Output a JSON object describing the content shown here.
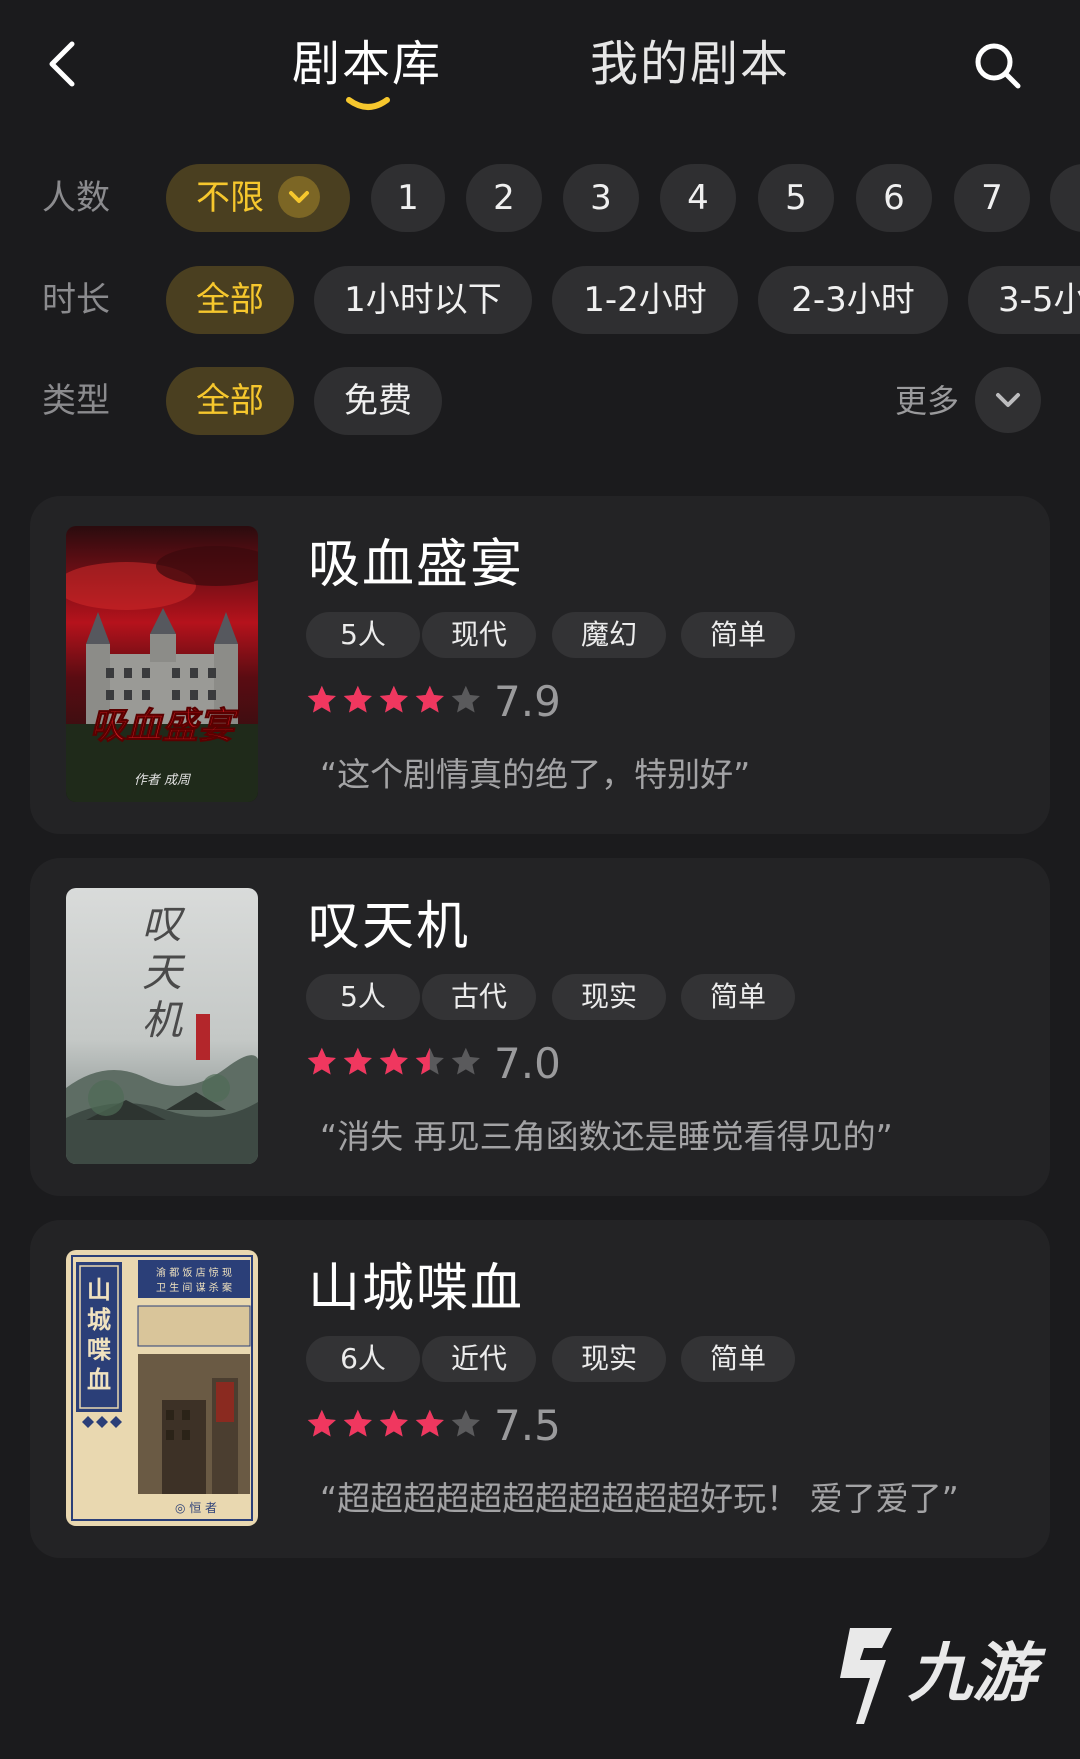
{
  "header": {
    "tabs": [
      {
        "label": "剧本库",
        "active": true
      },
      {
        "label": "我的剧本",
        "active": false
      }
    ],
    "accent_color": "#f6c72d"
  },
  "filters": {
    "players": {
      "label": "人数",
      "options": [
        "不限",
        "1",
        "2",
        "3",
        "4",
        "5",
        "6",
        "7"
      ],
      "selected": "不限"
    },
    "duration": {
      "label": "时长",
      "options": [
        "全部",
        "1小时以下",
        "1-2小时",
        "2-3小时",
        "3-5小"
      ],
      "selected": "全部"
    },
    "type": {
      "label": "类型",
      "options": [
        "全部",
        "免费"
      ],
      "selected": "全部",
      "more_label": "更多"
    }
  },
  "scripts": [
    {
      "title": "吸血盛宴",
      "tags": [
        "5人",
        "现代",
        "魔幻",
        "简单"
      ],
      "rating": 7.9,
      "stars": 4,
      "score_text": "7.9",
      "quote": "“这个剧情真的绝了，特别好”",
      "cover": {
        "title_art": "吸血盛宴",
        "author_line": "作者 成周"
      }
    },
    {
      "title": "叹天机",
      "tags": [
        "5人",
        "古代",
        "现实",
        "简单"
      ],
      "rating": 7.0,
      "stars": 3.5,
      "score_text": "7.0",
      "quote": "“消失 再见三角函数还是睡觉看得见的”",
      "cover": {
        "title_art": "叹天机"
      }
    },
    {
      "title": "山城喋血",
      "tags": [
        "6人",
        "近代",
        "现实",
        "简单"
      ],
      "rating": 7.5,
      "stars": 4,
      "score_text": "7.5",
      "quote": "“超超超超超超超超超超超好玩！ 爱了爱了”",
      "cover": {
        "title_art": "山城喋血",
        "subtitle_art": "渝都饭店惊现卫生间谋杀案",
        "author_line": "恒者"
      }
    }
  ],
  "watermark": {
    "text": "九游"
  },
  "colors": {
    "background": "#1b1b1d",
    "card": "#232325",
    "chip": "#2f2f31",
    "chip_active_bg": "#4a3f20",
    "star_on": "#f0375f",
    "star_off": "#5a5a5c"
  }
}
